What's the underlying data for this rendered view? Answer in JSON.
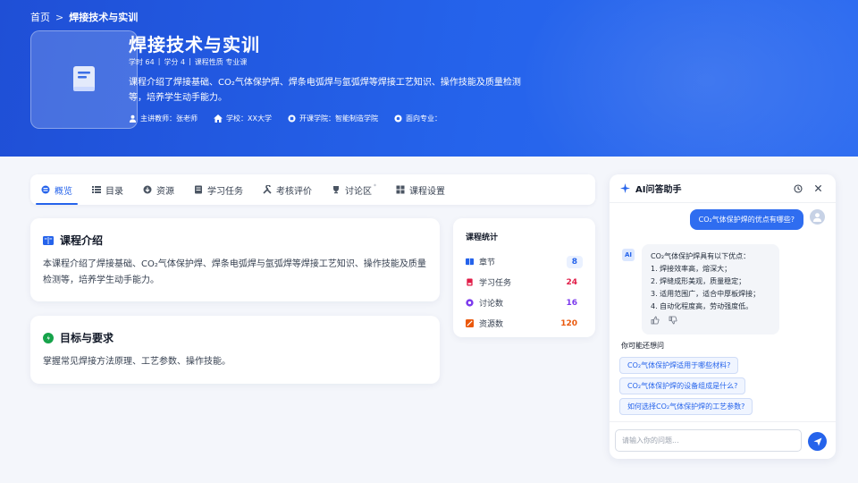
{
  "breadcrumb": {
    "home": "首页",
    "sep": ">",
    "current": "焊接技术与实训"
  },
  "course": {
    "title": "焊接技术与实训",
    "meta": [
      "学时 64",
      "|",
      "学分 4",
      "|",
      "课程性质 专业课"
    ],
    "description": "课程介绍了焊接基础、CO₂气体保护焊、焊条电弧焊与氩弧焊等焊接工艺知识、操作技能及质量检测等，培养学生动手能力。",
    "info": {
      "teacher": "主讲教师：张老师",
      "school": "学校：XX大学",
      "college": "开课学院：智能制造学院",
      "major": "面向专业："
    }
  },
  "tabs": [
    {
      "label": "概览",
      "icon": "overview-icon"
    },
    {
      "label": "目录",
      "icon": "list-icon"
    },
    {
      "label": "资源",
      "icon": "download-icon"
    },
    {
      "label": "学习任务",
      "icon": "task-icon"
    },
    {
      "label": "考核评价",
      "icon": "tools-icon"
    },
    {
      "label": "讨论区",
      "icon": "trophy-icon",
      "sup": "*"
    },
    {
      "label": "课程设置",
      "icon": "settings-icon"
    }
  ],
  "intro": {
    "title": "课程介绍",
    "body": "本课程介绍了焊接基础、CO₂气体保护焊、焊条电弧焊与氩弧焊等焊接工艺知识、操作技能及质量检测等，培养学生动手能力。"
  },
  "goals": {
    "title": "目标与要求",
    "body": "掌握常见焊接方法原理、工艺参数、操作技能。"
  },
  "stats": {
    "title": "课程统计",
    "rows": [
      {
        "label": "章节",
        "value": "8",
        "color": "#2563eb",
        "bg": "#eaf1ff"
      },
      {
        "label": "学习任务",
        "value": "24",
        "color": "#e11d48",
        "bg": "#ffffff"
      },
      {
        "label": "讨论数",
        "value": "16",
        "color": "#7c3aed",
        "bg": "#ffffff"
      },
      {
        "label": "资源数",
        "value": "120",
        "color": "#ea580c",
        "bg": "#ffffff"
      }
    ]
  },
  "ai": {
    "title": "AI问答助手",
    "user_question": "CO₂气体保护焊的优点有哪些?",
    "ai_badge": "AI",
    "answer_lines": [
      "CO₂气体保护焊具有以下优点：",
      "1. 焊接效率高，熔深大；",
      "2. 焊缝成形美观，质量稳定；",
      "3. 适用范围广，适合中厚板焊接；",
      "4. 自动化程度高，劳动强度低。"
    ],
    "suggest_title": "你可能还想问",
    "suggestions": [
      "CO₂气体保护焊适用于哪些材料?",
      "CO₂气体保护焊的设备组成是什么?",
      "如何选择CO₂气体保护焊的工艺参数?"
    ],
    "input_placeholder": "请输入你的问题..."
  }
}
